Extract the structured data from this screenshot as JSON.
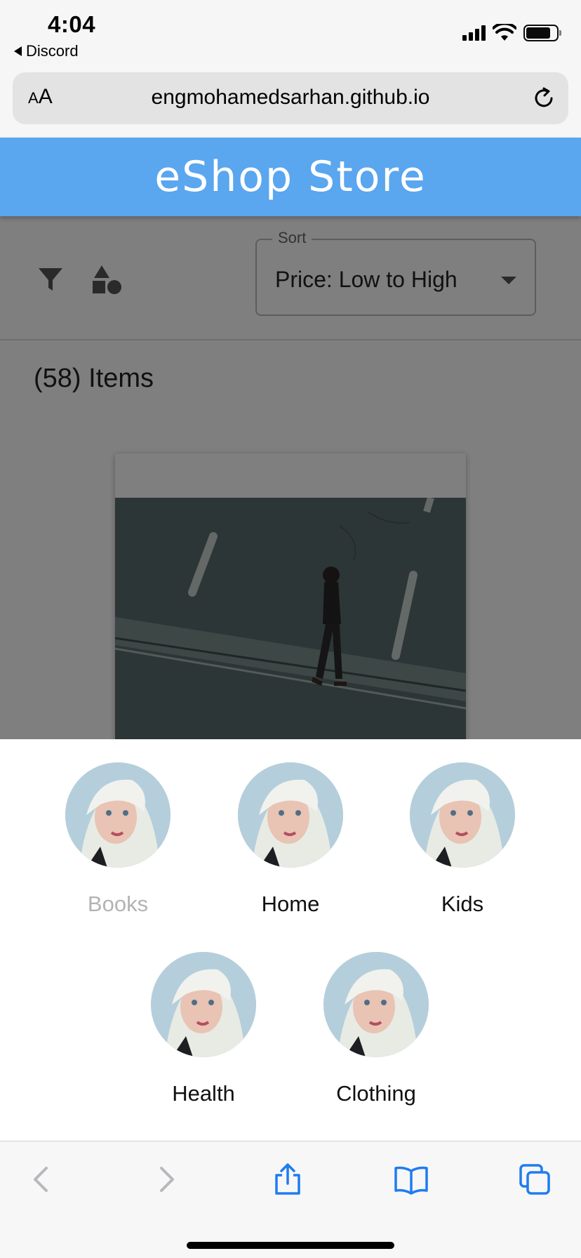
{
  "status_bar": {
    "time": "4:04",
    "back_app": "Discord",
    "icons": [
      "signal-icon",
      "wifi-icon",
      "battery-icon"
    ]
  },
  "browser": {
    "text_size_label_small": "A",
    "text_size_label_large": "A",
    "url": "engmohamedsarhan.github.io",
    "reload_icon": "reload-icon",
    "toolbar_icons": [
      "back-icon",
      "forward-icon",
      "share-icon",
      "bookmarks-icon",
      "tabs-icon"
    ]
  },
  "header": {
    "title": "eShop Store",
    "color": "#5aa6ef"
  },
  "filters": {
    "filter_icon": "filter-icon",
    "category_icon": "shapes-icon",
    "sort_label": "Sort",
    "sort_value": "Price: Low to High"
  },
  "items_count": "(58) Items",
  "categories": [
    {
      "label": "Books",
      "active": false
    },
    {
      "label": "Home",
      "active": true
    },
    {
      "label": "Kids",
      "active": true
    },
    {
      "label": "Health",
      "active": true
    },
    {
      "label": "Clothing",
      "active": true
    }
  ]
}
